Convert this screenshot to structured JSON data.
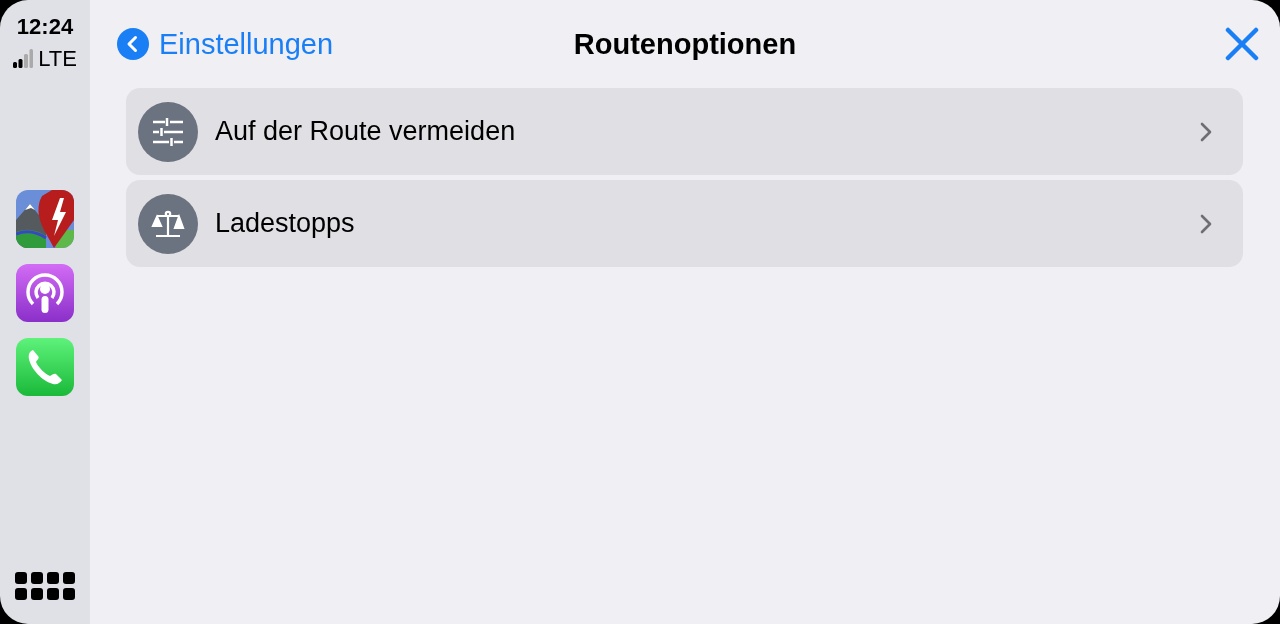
{
  "status_bar": {
    "time": "12:24",
    "network": "LTE"
  },
  "header": {
    "back_label": "Einstellungen",
    "title": "Routenoptionen"
  },
  "rows": [
    {
      "label": "Auf der Route vermeiden",
      "kind": "sliders"
    },
    {
      "label": "Ladestopps",
      "kind": "scale"
    }
  ]
}
